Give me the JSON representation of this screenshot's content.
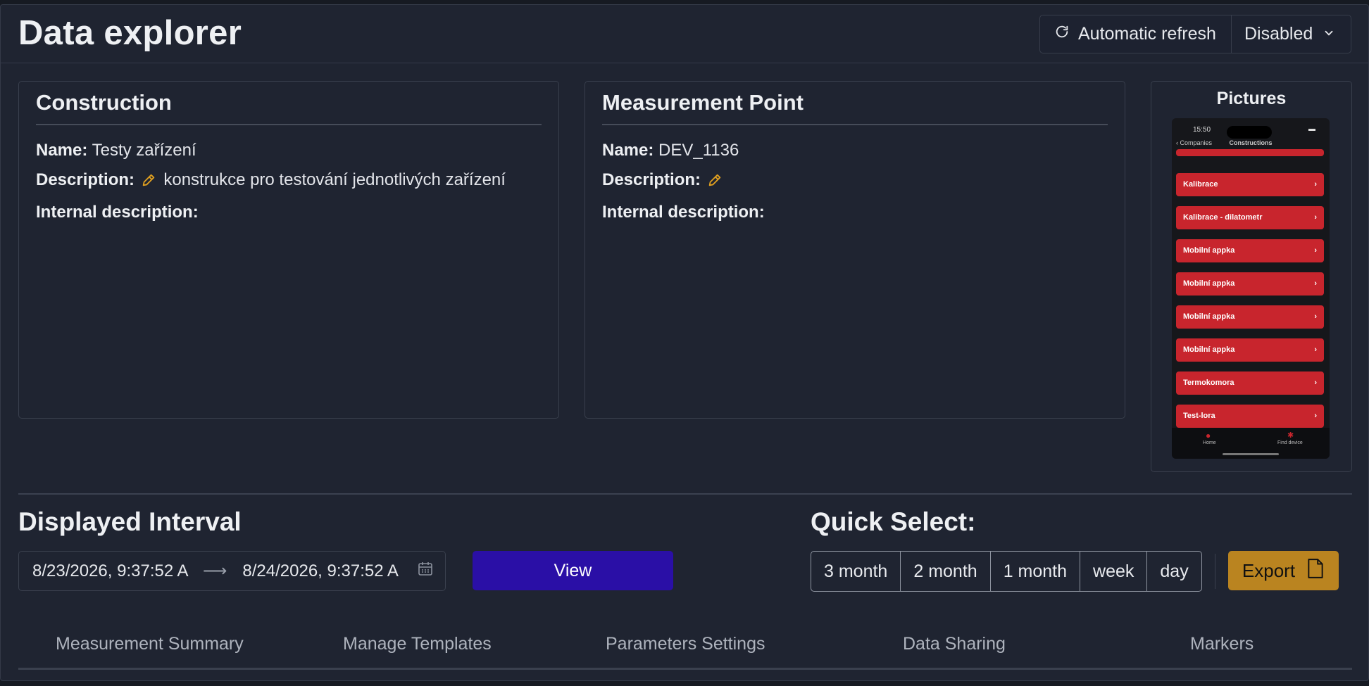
{
  "header": {
    "title": "Data explorer",
    "refresh_label": "Automatic refresh",
    "refresh_value": "Disabled"
  },
  "construction": {
    "heading": "Construction",
    "name_label": "Name:",
    "name_value": "Testy zařízení",
    "description_label": "Description:",
    "description_value": "konstrukce pro testování jednotlivých zařízení",
    "internal_label": "Internal description:"
  },
  "measurement_point": {
    "heading": "Measurement Point",
    "name_label": "Name:",
    "name_value": "DEV_1136",
    "description_label": "Description:",
    "internal_label": "Internal description:"
  },
  "pictures": {
    "heading": "Pictures",
    "phone": {
      "time": "15:50",
      "back_label": "Companies",
      "screen_title": "Constructions",
      "items": [
        "Kalibrace",
        "Kalibrace - dilatometr",
        "Mobilní appka",
        "Mobilní appka",
        "Mobilní appka",
        "Mobilní appka",
        "Termokomora",
        "Test-lora"
      ],
      "tab_home": "Home",
      "tab_find": "Find device"
    }
  },
  "interval": {
    "heading": "Displayed Interval",
    "start": "8/23/2026, 9:37:52 A",
    "end": "8/24/2026, 9:37:52 A",
    "view_label": "View"
  },
  "quick_select": {
    "heading": "Quick Select:",
    "options": [
      "3 month",
      "2 month",
      "1 month",
      "week",
      "day"
    ],
    "export_label": "Export"
  },
  "tabs": [
    "Measurement Summary",
    "Manage Templates",
    "Parameters Settings",
    "Data Sharing",
    "Markers"
  ],
  "colors": {
    "accent_view": "#2a0fa6",
    "accent_export": "#ba8420",
    "picture_item": "#c8252d",
    "pencil": "#e0a020"
  }
}
